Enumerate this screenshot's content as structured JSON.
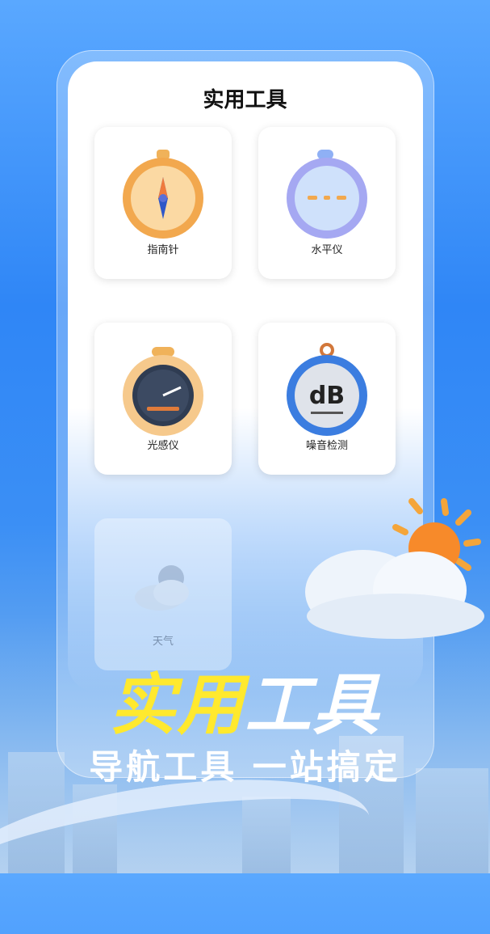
{
  "screen": {
    "title": "实用工具",
    "tools": [
      {
        "label": "指南针",
        "icon": "compass-icon"
      },
      {
        "label": "水平仪",
        "icon": "level-icon"
      },
      {
        "label": "光感仪",
        "icon": "light-meter-icon"
      },
      {
        "label": "噪音检测",
        "icon": "noise-meter-icon",
        "icon_text": "dB"
      },
      {
        "label": "天气",
        "icon": "weather-icon"
      }
    ]
  },
  "hero": {
    "title_part1": "实用",
    "title_part2": "工具",
    "subtitle": "导航工具 一站搞定"
  },
  "colors": {
    "accent_yellow": "#ffe92e",
    "background_blue": "#2f86f6"
  }
}
